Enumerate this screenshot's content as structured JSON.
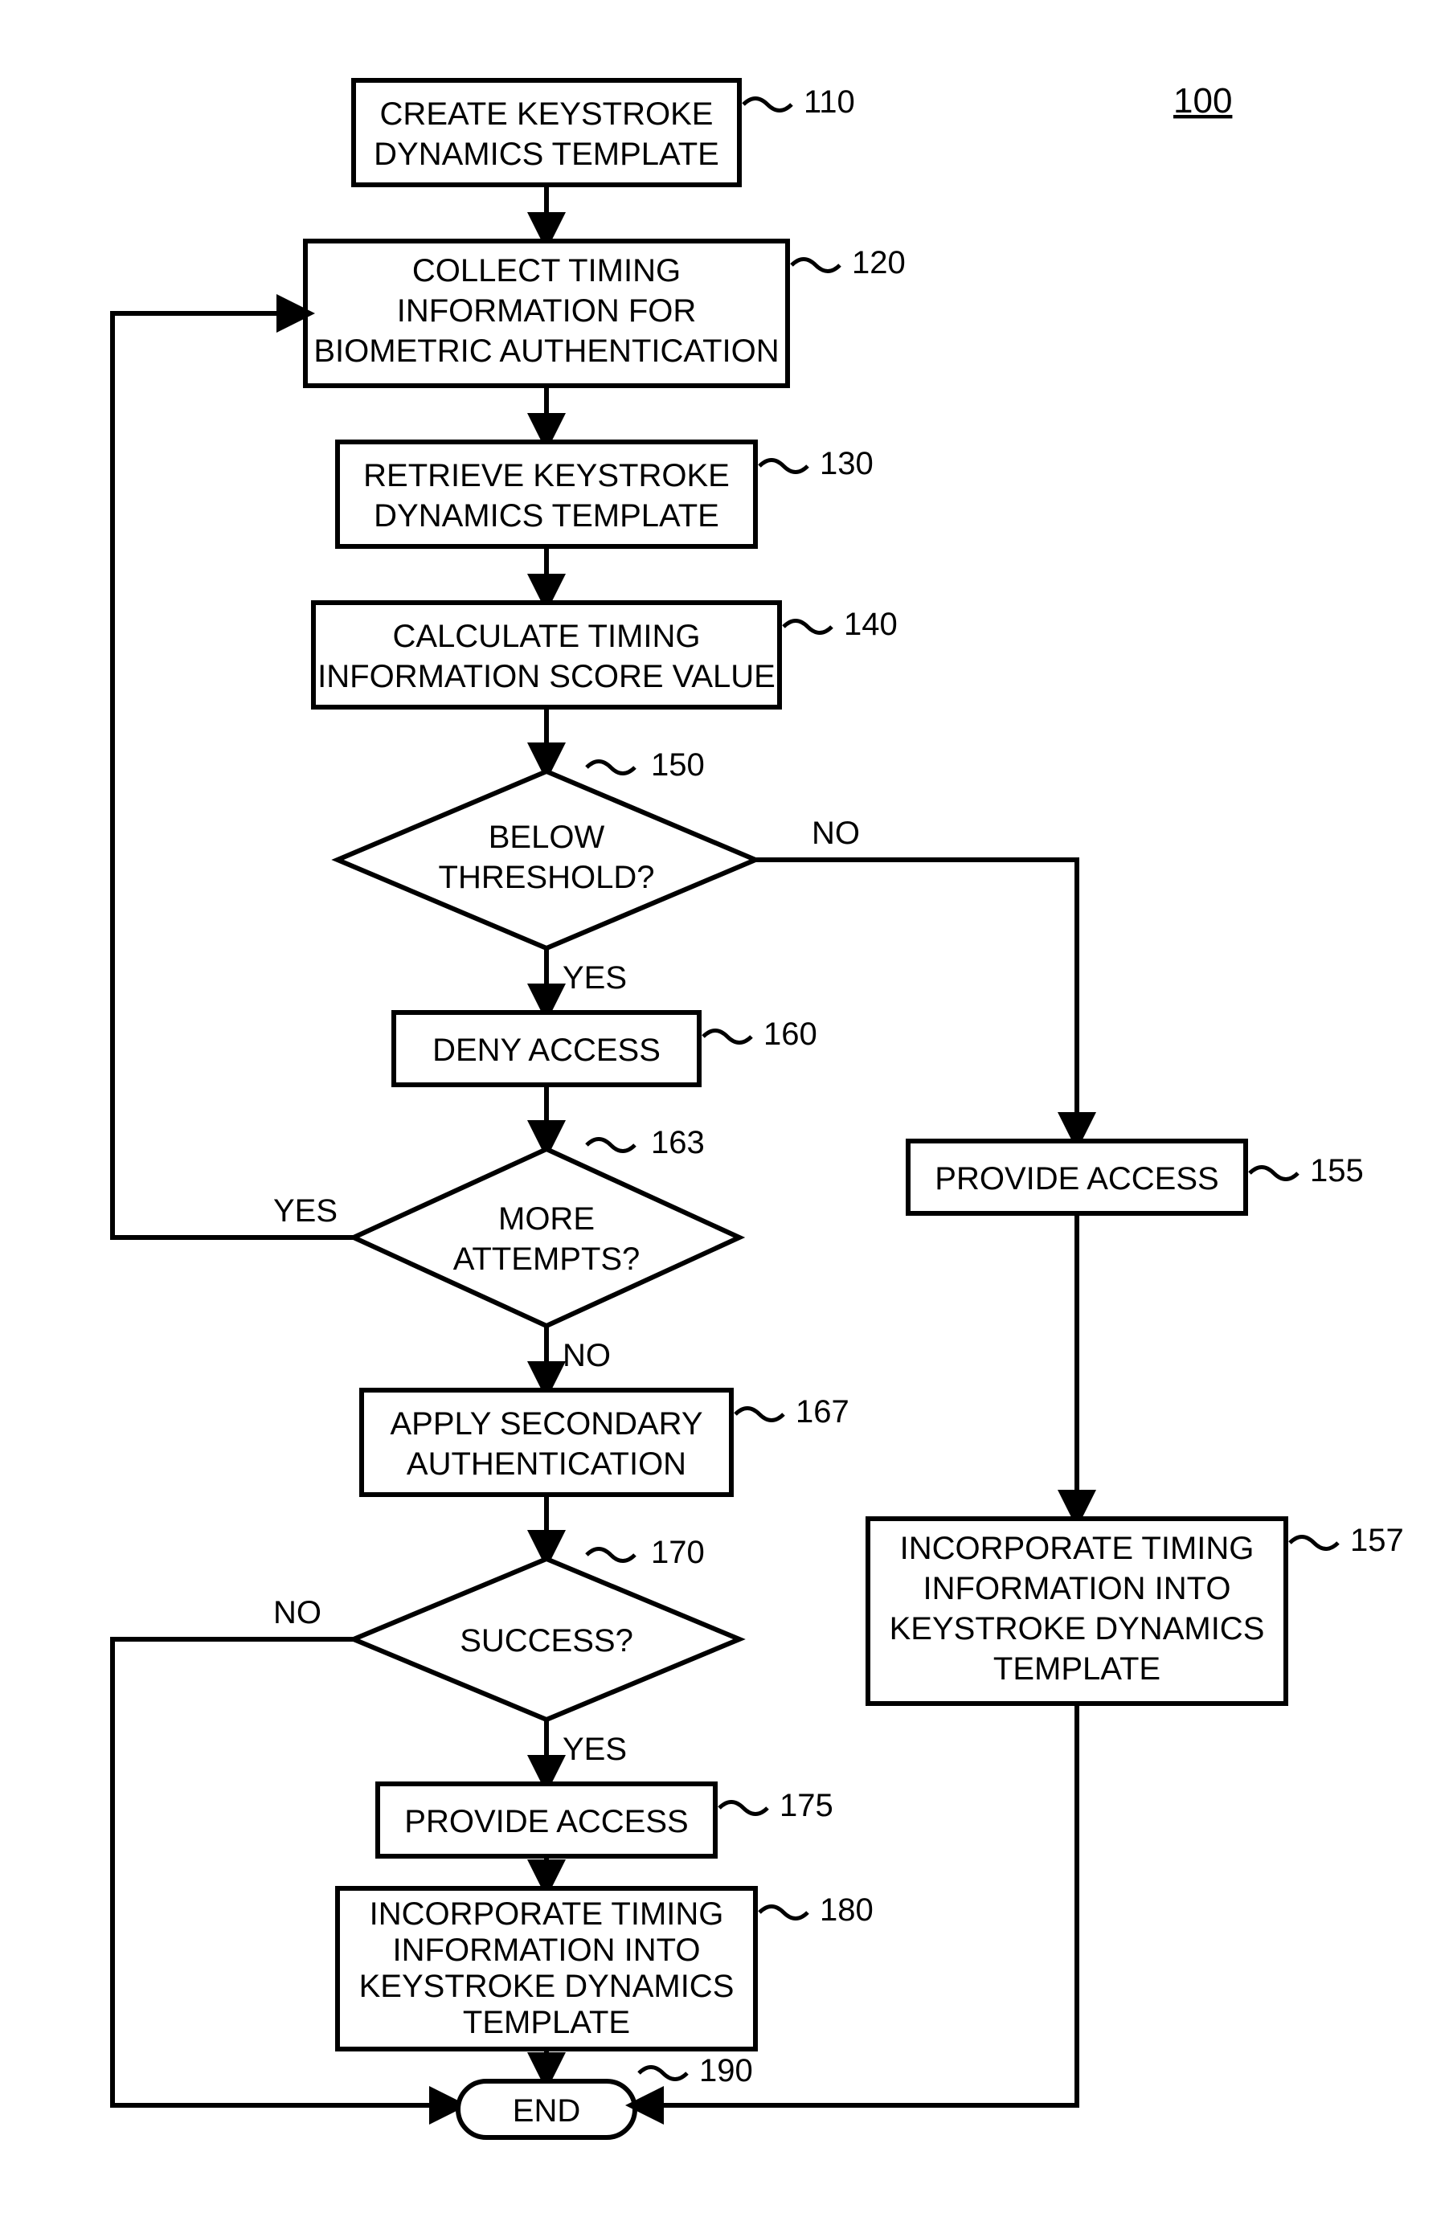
{
  "figure_label": "100",
  "nodes": {
    "n110": {
      "label": "110",
      "lines": [
        "CREATE KEYSTROKE",
        "DYNAMICS TEMPLATE"
      ]
    },
    "n120": {
      "label": "120",
      "lines": [
        "COLLECT TIMING",
        "INFORMATION FOR",
        "BIOMETRIC AUTHENTICATION"
      ]
    },
    "n130": {
      "label": "130",
      "lines": [
        "RETRIEVE KEYSTROKE",
        "DYNAMICS TEMPLATE"
      ]
    },
    "n140": {
      "label": "140",
      "lines": [
        "CALCULATE TIMING",
        "INFORMATION SCORE VALUE"
      ]
    },
    "n150": {
      "label": "150",
      "lines": [
        "BELOW",
        "THRESHOLD?"
      ],
      "yes": "YES",
      "no": "NO"
    },
    "n160": {
      "label": "160",
      "lines": [
        "DENY ACCESS"
      ]
    },
    "n163": {
      "label": "163",
      "lines": [
        "MORE",
        "ATTEMPTS?"
      ],
      "yes": "YES",
      "no": "NO"
    },
    "n167": {
      "label": "167",
      "lines": [
        "APPLY SECONDARY",
        "AUTHENTICATION"
      ]
    },
    "n170": {
      "label": "170",
      "lines": [
        "SUCCESS?"
      ],
      "yes": "YES",
      "no": "NO"
    },
    "n175": {
      "label": "175",
      "lines": [
        "PROVIDE ACCESS"
      ]
    },
    "n180": {
      "label": "180",
      "lines": [
        "INCORPORATE TIMING",
        "INFORMATION INTO",
        "KEYSTROKE DYNAMICS",
        "TEMPLATE"
      ]
    },
    "n190": {
      "label": "190",
      "lines": [
        "END"
      ]
    },
    "n155": {
      "label": "155",
      "lines": [
        "PROVIDE ACCESS"
      ]
    },
    "n157": {
      "label": "157",
      "lines": [
        "INCORPORATE TIMING",
        "INFORMATION INTO",
        "KEYSTROKE DYNAMICS",
        "TEMPLATE"
      ]
    }
  }
}
